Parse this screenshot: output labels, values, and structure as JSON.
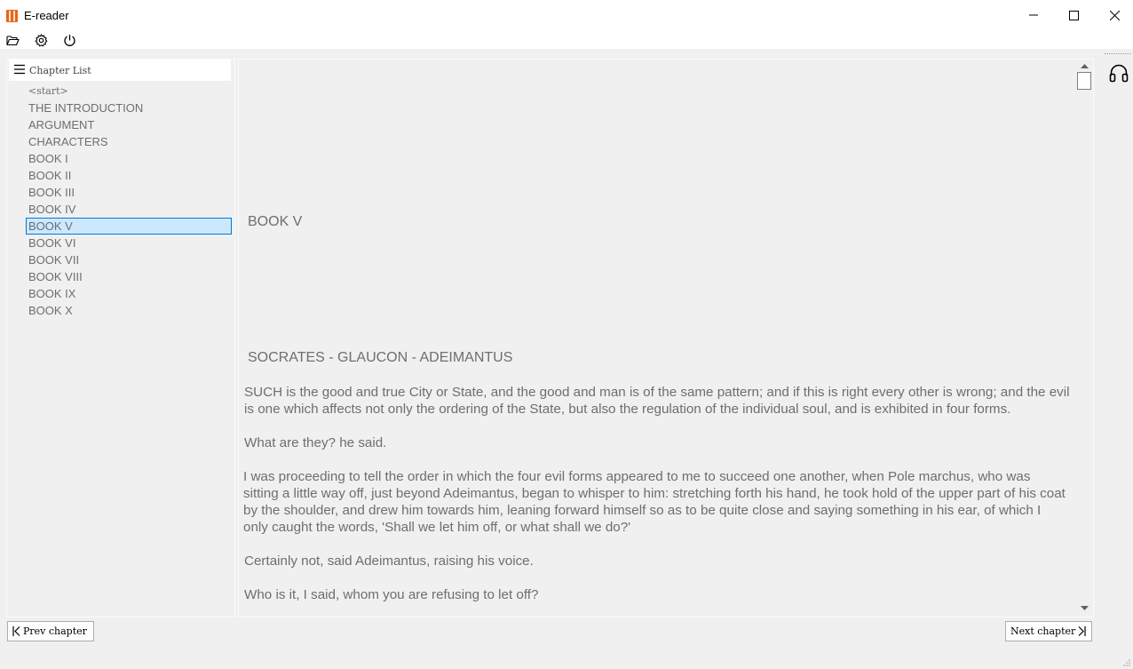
{
  "window": {
    "title": "E-reader"
  },
  "toolbar": {
    "open_icon": "folder-open-icon",
    "settings_icon": "gear-icon",
    "power_icon": "power-icon"
  },
  "sidebar": {
    "header_label": "Chapter List",
    "items": [
      {
        "label": "<start>"
      },
      {
        "label": "THE INTRODUCTION"
      },
      {
        "label": "ARGUMENT"
      },
      {
        "label": "CHARACTERS"
      },
      {
        "label": "BOOK I"
      },
      {
        "label": "BOOK II"
      },
      {
        "label": "BOOK III"
      },
      {
        "label": "BOOK IV"
      },
      {
        "label": "BOOK V"
      },
      {
        "label": "BOOK VI"
      },
      {
        "label": "BOOK VII"
      },
      {
        "label": "BOOK VIII"
      },
      {
        "label": "BOOK IX"
      },
      {
        "label": "BOOK X"
      }
    ],
    "selected": "BOOK V"
  },
  "content": {
    "chapter_title": "BOOK V",
    "speakers": "SOCRATES - GLAUCON - ADEIMANTUS",
    "paragraphs": [
      "SUCH is the good and true City or State, and the good and man is of the same pattern; and if this is right every other is wrong; and the evil is one which affects not only the ordering of the State, but also the regulation of the individual soul, and is exhibited in four forms.",
      "What are they? he said.",
      "I was proceeding to tell the order in which the four evil forms appeared to me to succeed one another, when Pole marchus, who was sitting a little way off, just beyond Adeimantus, began to whisper to him: stretching forth his hand, he took hold of the upper part of his coat by the shoulder, and drew him towards him, leaning forward himself so as to be quite close and saying something in his ear, of which I only caught the words, 'Shall we let him off, or what shall we do?'",
      "Certainly not, said Adeimantus, raising his voice.",
      "Who is it, I said, whom you are refusing to let off?"
    ]
  },
  "navigation": {
    "prev_label": "Prev chapter",
    "next_label": "Next chapter"
  },
  "side_tools": {
    "audio_icon": "headphones-icon"
  },
  "colors": {
    "selection_bg": "#cce8ff",
    "selection_border": "#0078d7",
    "text": "#6e6e6e",
    "app_icon": "#e8651a"
  }
}
